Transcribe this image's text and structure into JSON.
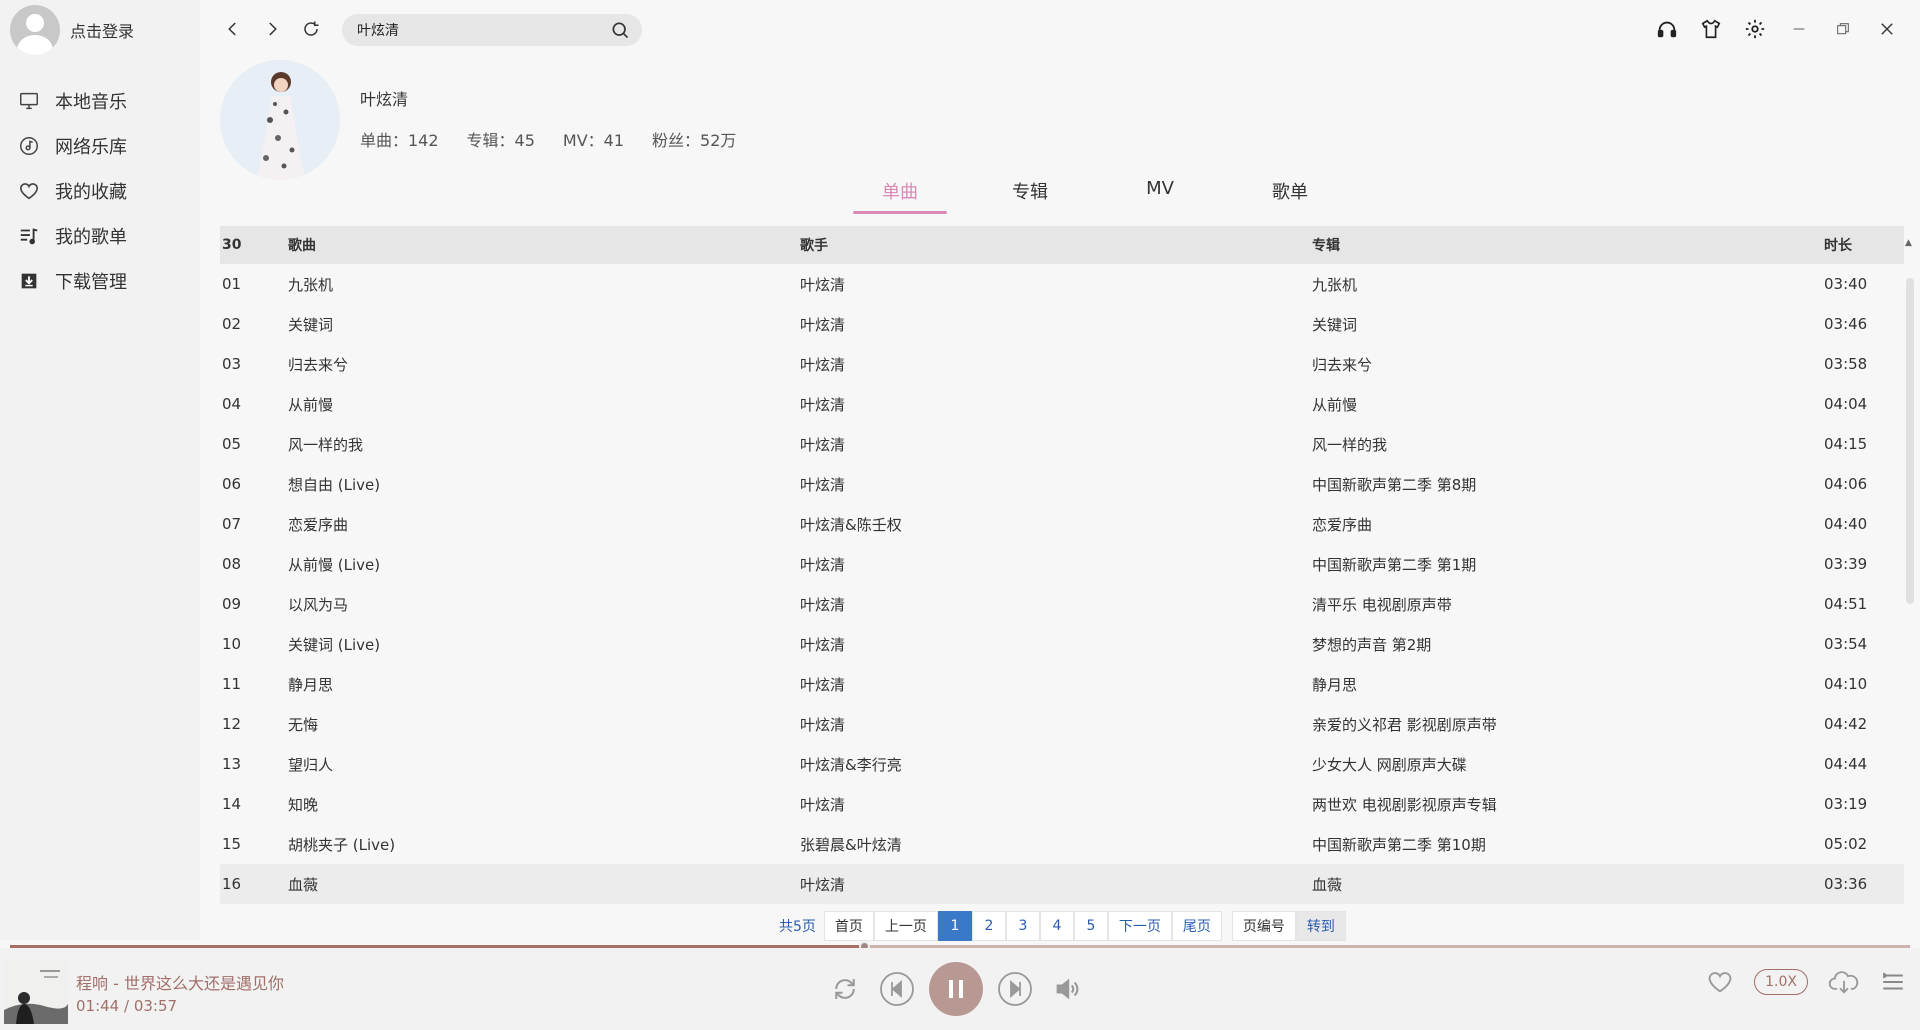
{
  "user": {
    "login_label": "点击登录"
  },
  "nav": [
    {
      "label": "本地音乐",
      "icon": "monitor-icon"
    },
    {
      "label": "网络乐库",
      "icon": "music-disc-icon"
    },
    {
      "label": "我的收藏",
      "icon": "heart-icon"
    },
    {
      "label": "我的歌单",
      "icon": "playlist-icon"
    },
    {
      "label": "下载管理",
      "icon": "download-icon"
    }
  ],
  "search": {
    "value": "叶炫清",
    "placeholder": ""
  },
  "artist": {
    "name": "叶炫清",
    "stats": [
      "单曲：142",
      "专辑：45",
      "MV：41",
      "粉丝：52万"
    ]
  },
  "tabs": [
    {
      "label": "单曲",
      "active": true
    },
    {
      "label": "专辑",
      "active": false
    },
    {
      "label": "MV",
      "active": false
    },
    {
      "label": "歌单",
      "active": false
    }
  ],
  "table": {
    "headers": {
      "num": "30",
      "title": "歌曲",
      "artist": "歌手",
      "album": "专辑",
      "duration": "时长"
    },
    "rows": [
      {
        "num": "01",
        "title": "九张机",
        "artist": "叶炫清",
        "album": "九张机",
        "duration": "03:40"
      },
      {
        "num": "02",
        "title": "关键词",
        "artist": "叶炫清",
        "album": "关键词",
        "duration": "03:46"
      },
      {
        "num": "03",
        "title": "归去来兮",
        "artist": "叶炫清",
        "album": "归去来兮",
        "duration": "03:58"
      },
      {
        "num": "04",
        "title": "从前慢",
        "artist": "叶炫清",
        "album": "从前慢",
        "duration": "04:04"
      },
      {
        "num": "05",
        "title": "风一样的我",
        "artist": "叶炫清",
        "album": "风一样的我",
        "duration": "04:15"
      },
      {
        "num": "06",
        "title": "想自由 (Live)",
        "artist": "叶炫清",
        "album": "中国新歌声第二季 第8期",
        "duration": "04:06"
      },
      {
        "num": "07",
        "title": "恋爱序曲",
        "artist": "叶炫清&陈壬权",
        "album": "恋爱序曲",
        "duration": "04:40"
      },
      {
        "num": "08",
        "title": "从前慢 (Live)",
        "artist": "叶炫清",
        "album": "中国新歌声第二季 第1期",
        "duration": "03:39"
      },
      {
        "num": "09",
        "title": "以风为马",
        "artist": "叶炫清",
        "album": "清平乐 电视剧原声带",
        "duration": "04:51"
      },
      {
        "num": "10",
        "title": "关键词 (Live)",
        "artist": "叶炫清",
        "album": "梦想的声音 第2期",
        "duration": "03:54"
      },
      {
        "num": "11",
        "title": "静月思",
        "artist": "叶炫清",
        "album": "静月思",
        "duration": "04:10"
      },
      {
        "num": "12",
        "title": "无悔",
        "artist": "叶炫清",
        "album": "亲爱的义祁君 影视剧原声带",
        "duration": "04:42"
      },
      {
        "num": "13",
        "title": "望归人",
        "artist": "叶炫清&李行亮",
        "album": "少女大人 网剧原声大碟",
        "duration": "04:44"
      },
      {
        "num": "14",
        "title": "知晚",
        "artist": "叶炫清",
        "album": "两世欢 电视剧影视原声专辑",
        "duration": "03:19"
      },
      {
        "num": "15",
        "title": "胡桃夹子 (Live)",
        "artist": "张碧晨&叶炫清",
        "album": "中国新歌声第二季 第10期",
        "duration": "05:02"
      },
      {
        "num": "16",
        "title": "血薇",
        "artist": "叶炫清",
        "album": "血薇",
        "duration": "03:36"
      }
    ]
  },
  "pager": {
    "total": "共5页",
    "first": "首页",
    "prev": "上一页",
    "pages": [
      "1",
      "2",
      "3",
      "4",
      "5"
    ],
    "active_page": "1",
    "next": "下一页",
    "last": "尾页",
    "page_input_placeholder": "页编号",
    "go": "转到"
  },
  "player": {
    "title": "程响 - 世界这么大还是遇见你",
    "time": "01:44 / 03:57",
    "progress_fraction": 0.45,
    "speed": "1.0X"
  },
  "colors": {
    "accent_pink": "#d98ab7",
    "player_brown": "#a26f69",
    "page_active": "#3a78c8"
  }
}
